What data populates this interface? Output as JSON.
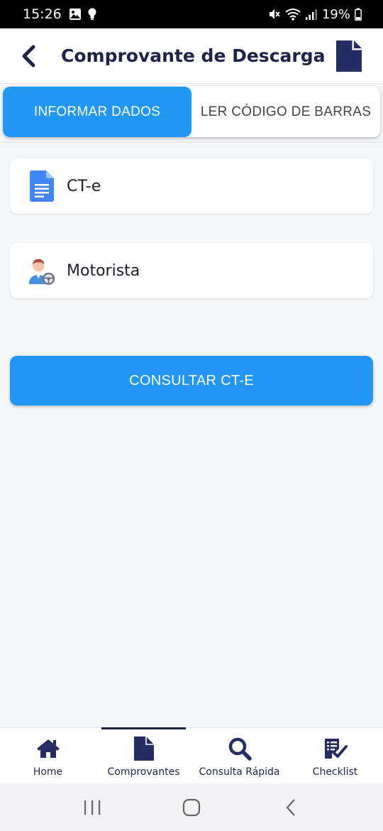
{
  "status_bar": {
    "time": "15:26",
    "battery": "19%"
  },
  "header": {
    "title": "Comprovante de Descarga"
  },
  "tabs": [
    {
      "label": "INFORMAR DADOS",
      "active": true
    },
    {
      "label": "LER CÓDIGO DE BARRAS",
      "active": false
    }
  ],
  "cards": [
    {
      "label": "CT-e",
      "icon": "document-icon"
    },
    {
      "label": "Motorista",
      "icon": "driver-icon"
    }
  ],
  "action": {
    "label": "CONSULTAR CT-E"
  },
  "bottom_nav": [
    {
      "label": "Home",
      "icon": "home-icon"
    },
    {
      "label": "Comprovantes",
      "icon": "document-icon",
      "active": true
    },
    {
      "label": "Consulta Rápida",
      "icon": "search-icon"
    },
    {
      "label": "Checklist",
      "icon": "checklist-icon"
    }
  ],
  "colors": {
    "primary": "#2196f3",
    "navy": "#1e2447",
    "background": "#f5f6f8"
  }
}
